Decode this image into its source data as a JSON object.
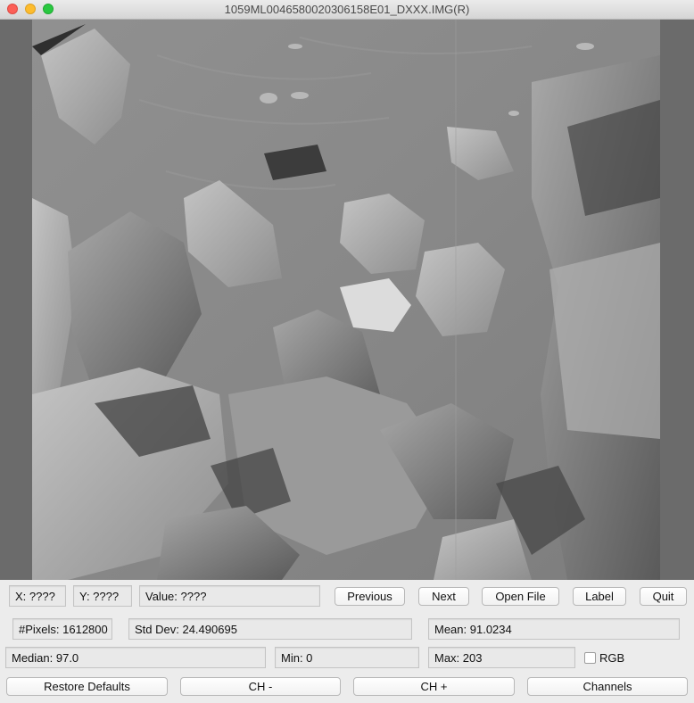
{
  "window": {
    "title": "1059ML0046580020306158E01_DXXX.IMG(R)"
  },
  "image": {
    "description_icon": "grayscale-terrain-image"
  },
  "row1": {
    "x_readout": "X: ????",
    "y_readout": "Y: ????",
    "value_readout": "Value: ????",
    "previous": "Previous",
    "next": "Next",
    "open_file": "Open File",
    "label": "Label",
    "quit": "Quit"
  },
  "row2": {
    "pixels": "#Pixels: 1612800",
    "std_dev": "Std Dev: 24.490695",
    "mean": "Mean: 91.0234"
  },
  "row3": {
    "median": "Median: 97.0",
    "min": "Min: 0",
    "max": "Max: 203",
    "rgb_label": "RGB",
    "rgb_checked": false
  },
  "row4": {
    "restore_defaults": "Restore Defaults",
    "ch_minus": "CH -",
    "ch_plus": "CH +",
    "channels": "Channels"
  },
  "colors": {
    "image_bg": "#8a8a8a",
    "rock_light": "#bdbdbd",
    "rock_shadow": "#2e2e2e"
  }
}
